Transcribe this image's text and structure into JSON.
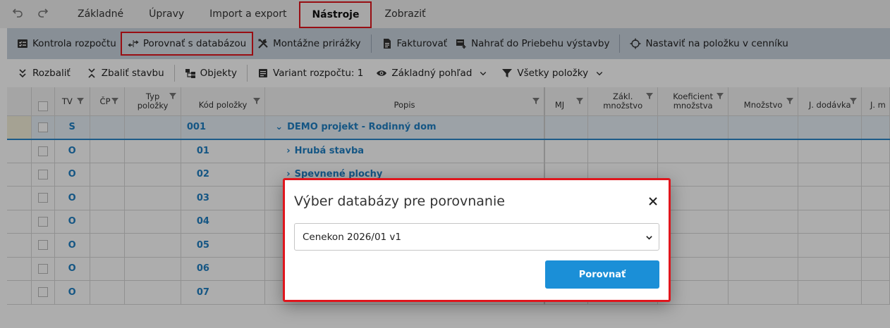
{
  "ribbon": {
    "tabs": [
      "Základné",
      "Úpravy",
      "Import a export",
      "Nástroje",
      "Zobraziť"
    ],
    "active_tab": "Nástroje"
  },
  "toolbar1": {
    "kontrola": "Kontrola rozpočtu",
    "porovnat": "Porovnať s databázou",
    "montazne": "Montážne prirážky",
    "fakturovat": "Fakturovať",
    "nahrat": "Nahrať do Priebehu výstavby",
    "nastavit": "Nastaviť na položku v cenníku"
  },
  "toolbar2": {
    "rozbalit": "Rozbaliť",
    "zbalit": "Zbaliť stavbu",
    "objekty": "Objekty",
    "variant": "Variant rozpočtu: 1",
    "pohlad": "Základný pohľad",
    "polozky": "Všetky položky"
  },
  "grid": {
    "headers": {
      "tv": "TV",
      "cp": "ČP",
      "typ1": "Typ",
      "typ2": "položky",
      "kod": "Kód položky",
      "popis": "Popis",
      "mj": "MJ",
      "zakl1": "Zákl.",
      "zakl2": "množstvo",
      "koef1": "Koeficient",
      "koef2": "množstva",
      "mnozstvo": "Množstvo",
      "jdodavka": "J. dodávka",
      "jm": "J. m"
    },
    "rows": [
      {
        "tv": "S",
        "kod": "001",
        "popis": "DEMO projekt - Rodinný dom"
      },
      {
        "tv": "O",
        "kod": "01",
        "popis": "Hrubá stavba"
      },
      {
        "tv": "O",
        "kod": "02",
        "popis": "Spevnené plochy"
      },
      {
        "tv": "O",
        "kod": "03",
        "popis": ""
      },
      {
        "tv": "O",
        "kod": "04",
        "popis": ""
      },
      {
        "tv": "O",
        "kod": "05",
        "popis": ""
      },
      {
        "tv": "O",
        "kod": "06",
        "popis": ""
      },
      {
        "tv": "O",
        "kod": "07",
        "popis": ""
      }
    ]
  },
  "modal": {
    "title": "Výber databázy pre porovnanie",
    "selected_db": "Cenekon 2026/01 v1",
    "submit": "Porovnať"
  },
  "colors": {
    "accent_blue": "#1b8fd7",
    "highlight_red": "#e0161d",
    "toolbar_bg": "#c9d3de"
  }
}
